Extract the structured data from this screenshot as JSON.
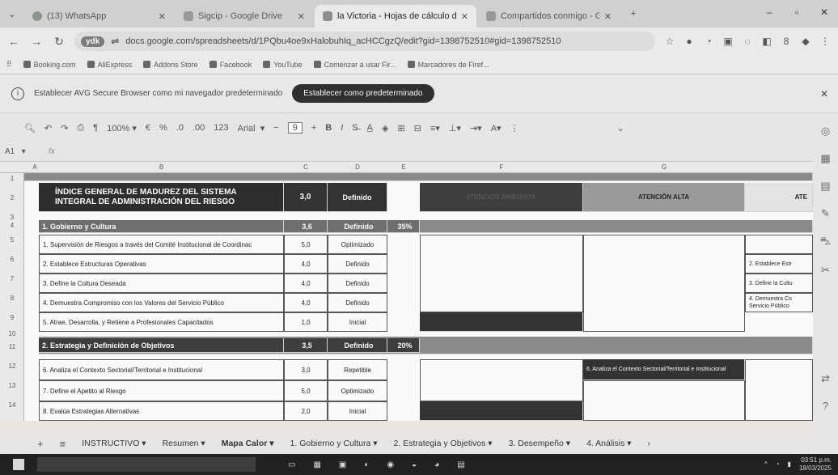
{
  "browser": {
    "tabs": [
      {
        "title": "(13) WhatsApp",
        "icon": "whatsapp-icon"
      },
      {
        "title": "Sigcip - Google Drive",
        "icon": "drive-icon"
      },
      {
        "title": "la Victoria - Hojas de cálculo d",
        "icon": "sheets-icon"
      },
      {
        "title": "Compartidos conmigo - Goog",
        "icon": "drive-icon"
      }
    ],
    "new_tab": "+",
    "url": "docs.google.com/spreadsheets/d/1PQbu4oe9xHalobuhIq_acHCCgzQ/edit?gid=1398752510#gid=1398752510",
    "profile_badge": "ydk"
  },
  "bookmarks": [
    "Booking.com",
    "AliExpress",
    "Addons Store",
    "Facebook",
    "YouTube",
    "Comenzar a usar Fir...",
    "Marcadores de Firef..."
  ],
  "banner": {
    "text": "Establecer AVG Secure Browser como mi navegador predeterminado",
    "button": "Establecer como predeterminado"
  },
  "toolbar": {
    "zoom": "100%",
    "currency": "€",
    "percent": "%",
    "dec_less": ".0",
    "dec_more": ".00",
    "number_fmt": "123",
    "font": "Arial",
    "font_size": "9",
    "bold": "B",
    "italic": "I"
  },
  "formula": {
    "cell_ref": "A1",
    "fx": "fx"
  },
  "columns": [
    "A",
    "B",
    "C",
    "D",
    "E",
    "F",
    "G"
  ],
  "rows": [
    "1",
    "2",
    "3",
    "4",
    "5",
    "6",
    "7",
    "8",
    "9",
    "10",
    "11",
    "12",
    "13",
    "14"
  ],
  "sheet": {
    "title_line1": "ÍNDICE GENERAL DE MADUREZ DEL SISTEMA",
    "title_line2": "INTEGRAL DE ADMINISTRACIÓN DEL RIESGO",
    "title_score": "3,0",
    "title_level": "Definido",
    "attention_headers": [
      "ATENCIÓN INMEDIATA",
      "ATENCIÓN ALTA",
      "ATE"
    ],
    "section1": {
      "name": "1. Gobierno y Cultura",
      "score": "3,6",
      "level": "Definido",
      "weight": "35%"
    },
    "section1_items": [
      {
        "label": "1.  Supervisión de Riesgos a través del Comité Institucional de Coordinac",
        "score": "5,0",
        "level": "Optimizado"
      },
      {
        "label": "2.  Establece Estructuras Operativas",
        "score": "4,0",
        "level": "Definido"
      },
      {
        "label": "3.  Define la Cultura Deseada",
        "score": "4,0",
        "level": "Definido"
      },
      {
        "label": "4.  Demuestra Compromiso con los Valores del Servicio Público",
        "score": "4,0",
        "level": "Definido"
      },
      {
        "label": "5.  Atrae, Desarrolla, y Retiene a Profesionales Capacitados",
        "score": "1,0",
        "level": "Inicial"
      }
    ],
    "section1_attention": [
      "2.  Establece Estr",
      "3.  Define la Cultu",
      "4.  Demuestra Co Servicio Público"
    ],
    "section2": {
      "name": "2. Estrategia y Definición de Objetivos",
      "score": "3,5",
      "level": "Definido",
      "weight": "20%"
    },
    "section2_items": [
      {
        "label": "6. Analiza el Contexto Sectorial/Territorial e Institucional",
        "score": "3,0",
        "level": "Repetible"
      },
      {
        "label": "7. Define el Apetito al Riesgo",
        "score": "5,0",
        "level": "Optimizado"
      },
      {
        "label": "8. Evalúa Estrategias Alternativas",
        "score": "2,0",
        "level": "Inicial"
      }
    ],
    "section2_attention": "6. Analiza el Contexto Sectorial/Territorial e Institucional"
  },
  "sheet_tabs": [
    "INSTRUCTIVO",
    "Resumen",
    "Mapa Calor",
    "1. Gobierno y Cultura",
    "2. Estrategia y Objetivos",
    "3. Desempeño",
    "4. Análisis"
  ],
  "active_sheet": "Mapa Calor",
  "taskbar": {
    "time": "03:51 p.m.",
    "date": "18/03/2025"
  }
}
